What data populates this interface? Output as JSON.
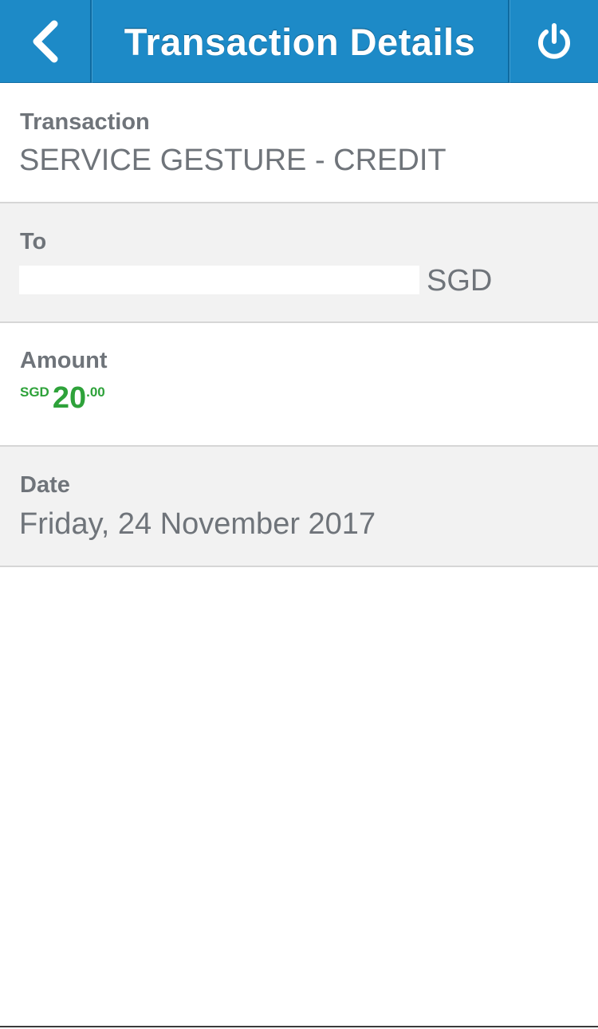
{
  "header": {
    "title": "Transaction Details",
    "back_icon": "chevron-left-icon",
    "power_icon": "power-icon",
    "background_color": "#1d8ac7"
  },
  "details": {
    "transaction": {
      "label": "Transaction",
      "value": "SERVICE GESTURE - CREDIT"
    },
    "to": {
      "label": "To",
      "value_suffix": "SGD"
    },
    "amount": {
      "label": "Amount",
      "currency": "SGD",
      "whole": "20",
      "decimal": ".00",
      "color": "#2ea23a"
    },
    "date": {
      "label": "Date",
      "value": "Friday, 24 November 2017"
    }
  }
}
